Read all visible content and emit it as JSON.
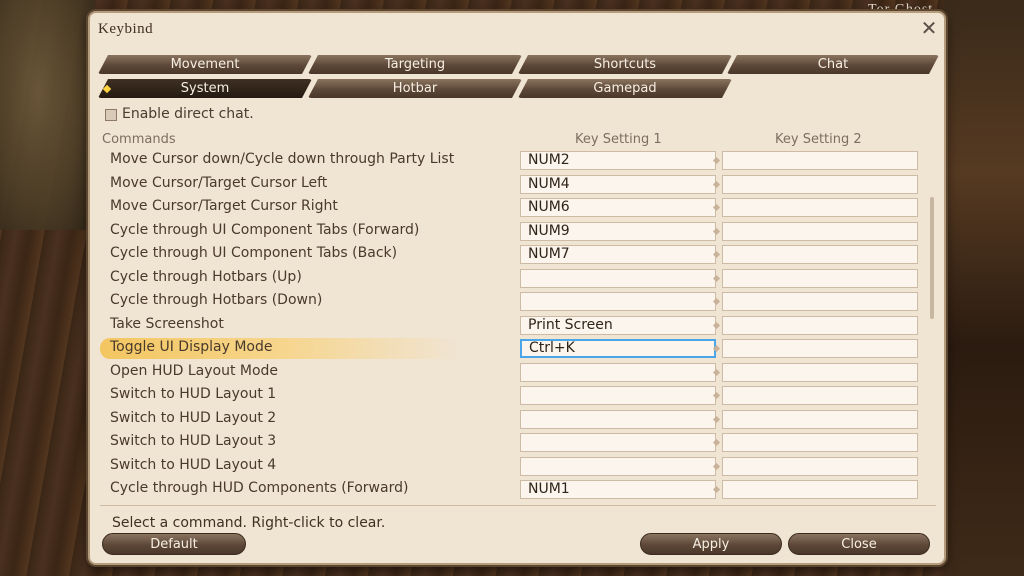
{
  "window": {
    "title": "Keybind"
  },
  "tabs": [
    {
      "label": "Movement",
      "active": false
    },
    {
      "label": "Targeting",
      "active": false
    },
    {
      "label": "Shortcuts",
      "active": false
    },
    {
      "label": "Chat",
      "active": false
    },
    {
      "label": "System",
      "active": true
    },
    {
      "label": "Hotbar",
      "active": false
    },
    {
      "label": "Gamepad",
      "active": false
    }
  ],
  "options": {
    "enable_direct_chat": "Enable direct chat.",
    "enable_direct_chat_checked": false
  },
  "columns": {
    "commands": "Commands",
    "key1": "Key Setting 1",
    "key2": "Key Setting 2"
  },
  "rows": [
    {
      "command": "Move Cursor down/Cycle down through Party List",
      "key1": "NUM2",
      "key2": ""
    },
    {
      "command": "Move Cursor/Target Cursor Left",
      "key1": "NUM4",
      "key2": ""
    },
    {
      "command": "Move Cursor/Target Cursor Right",
      "key1": "NUM6",
      "key2": ""
    },
    {
      "command": "Cycle through UI Component Tabs (Forward)",
      "key1": "NUM9",
      "key2": ""
    },
    {
      "command": "Cycle through UI Component Tabs (Back)",
      "key1": "NUM7",
      "key2": ""
    },
    {
      "command": "Cycle through Hotbars (Up)",
      "key1": "",
      "key2": ""
    },
    {
      "command": "Cycle through Hotbars (Down)",
      "key1": "",
      "key2": ""
    },
    {
      "command": "Take Screenshot",
      "key1": "Print Screen",
      "key2": ""
    },
    {
      "command": "Toggle UI Display Mode",
      "key1": "Ctrl+K",
      "key2": "",
      "selected": true
    },
    {
      "command": "Open HUD Layout Mode",
      "key1": "",
      "key2": ""
    },
    {
      "command": "Switch to HUD Layout 1",
      "key1": "",
      "key2": ""
    },
    {
      "command": "Switch to HUD Layout 2",
      "key1": "",
      "key2": ""
    },
    {
      "command": "Switch to HUD Layout 3",
      "key1": "",
      "key2": ""
    },
    {
      "command": "Switch to HUD Layout 4",
      "key1": "",
      "key2": ""
    },
    {
      "command": "Cycle through HUD Components (Forward)",
      "key1": "NUM1",
      "key2": ""
    }
  ],
  "footer": {
    "hint": "Select a command. Right-click to clear.",
    "default_label": "Default",
    "apply_label": "Apply",
    "close_label": "Close"
  },
  "background": {
    "top_text": "Tor Ghost"
  },
  "icons": {
    "close": "close-icon",
    "checkbox": "checkbox-icon",
    "separator": "diamond-icon"
  },
  "colors": {
    "selection": "#f3c660",
    "focus": "#4aa6e8",
    "panel": "#f0e4d3",
    "tab": "#5d4838"
  }
}
